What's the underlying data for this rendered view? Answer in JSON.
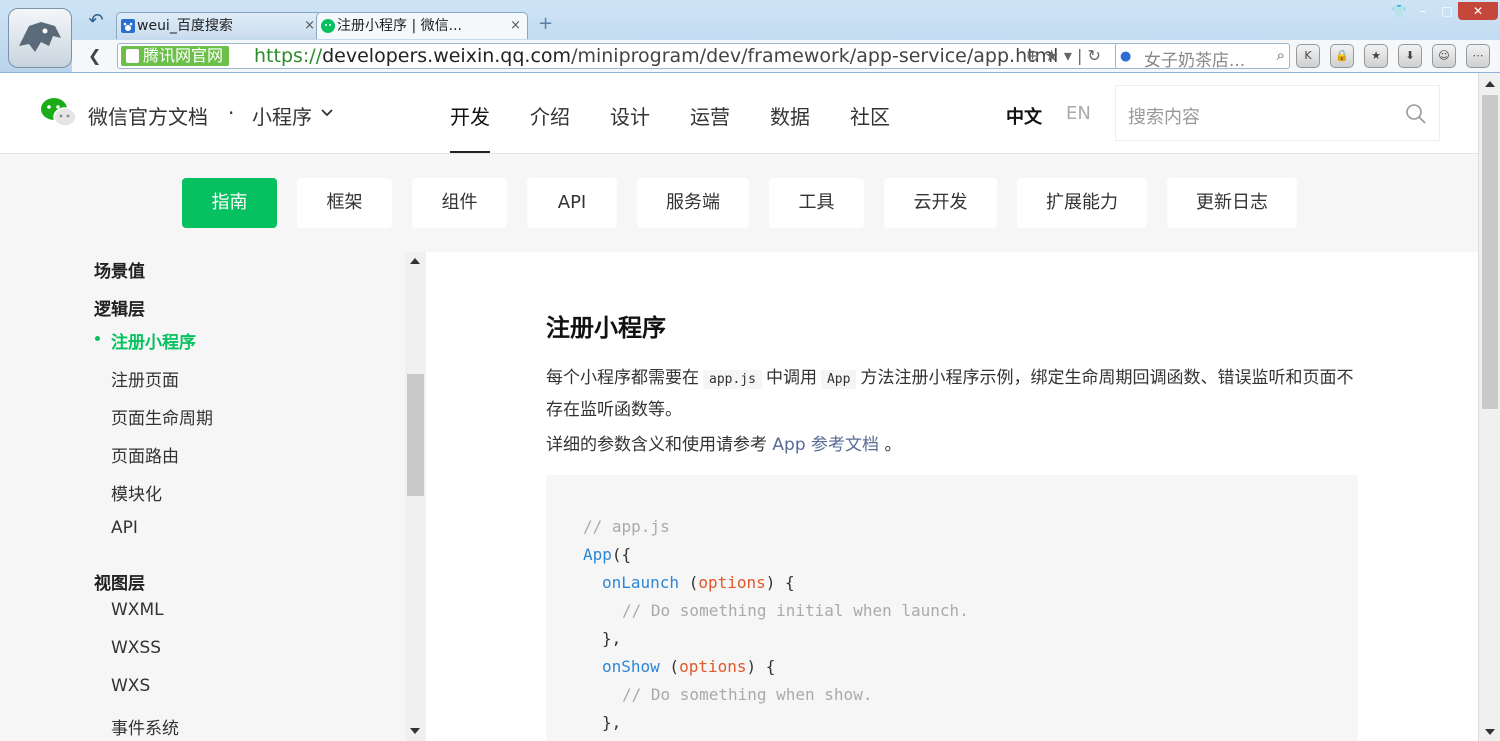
{
  "browser": {
    "tabs": [
      {
        "label": "weui_百度搜索",
        "close": "×"
      },
      {
        "label": "注册小程序 | 微信...",
        "close": "×"
      }
    ],
    "new_tab": "+",
    "window_controls": {
      "skin": "👕",
      "minimize": "–",
      "maximize": "□",
      "close": "✕"
    },
    "back": "❮",
    "site_badge": "腾讯网官网",
    "url": {
      "scheme": "https://",
      "host": "developers.weixin.qq.com",
      "path": "/miniprogram/dev/framework/app-service/app.html"
    },
    "url_icons": "⊕ ★ ▾ | ↻",
    "search": {
      "placeholder": "女子奶茶店...",
      "engine_icon": "baidu-paw-icon"
    },
    "extensions": [
      "K",
      "🔒",
      "★",
      "⬇",
      "☺",
      "⋯"
    ]
  },
  "header": {
    "brand": "微信官方文档",
    "separator": "·",
    "product": "小程序",
    "nav": [
      {
        "label": "开发",
        "active": true
      },
      {
        "label": "介绍"
      },
      {
        "label": "设计"
      },
      {
        "label": "运营"
      },
      {
        "label": "数据"
      },
      {
        "label": "社区"
      }
    ],
    "lang_zh": "中文",
    "lang_en": "EN",
    "search_placeholder": "搜索内容"
  },
  "categories": [
    {
      "label": "指南",
      "active": true
    },
    {
      "label": "框架"
    },
    {
      "label": "组件"
    },
    {
      "label": "API"
    },
    {
      "label": "服务端"
    },
    {
      "label": "工具"
    },
    {
      "label": "云开发"
    },
    {
      "label": "扩展能力"
    },
    {
      "label": "更新日志"
    }
  ],
  "sidebar": {
    "groups": [
      "场景值",
      "逻辑层",
      "视图层"
    ],
    "items": [
      "注册小程序",
      "注册页面",
      "页面生命周期",
      "页面路由",
      "模块化",
      "API",
      "WXML",
      "WXSS",
      "WXS",
      "事件系统"
    ]
  },
  "content": {
    "title": "注册小程序",
    "p1_a": "每个小程序都需要在",
    "p1_code1": "app.js",
    "p1_b": "中调用",
    "p1_code2": "App",
    "p1_c": "方法注册小程序示例，绑定生命周期回调函数、错误监听和页面不存在监听函数等。",
    "p2_a": "详细的参数含义和使用请参考",
    "p2_link": "App 参考文档",
    "p2_b": "。",
    "code": {
      "l1": "// app.js",
      "l2_fn": "App",
      "l2_rest": "({",
      "l3_fn": "onLaunch",
      "l3_a": " (",
      "l3_param": "options",
      "l3_b": ") {",
      "l4": "// Do something initial when launch.",
      "l5": "},",
      "l6_fn": "onShow",
      "l6_a": " (",
      "l6_param": "options",
      "l6_b": ") {",
      "l7": "// Do something when show.",
      "l8": "},"
    }
  },
  "colors": {
    "accent": "#07c160",
    "link": "#576b95",
    "code_function": "#2f86d6",
    "code_param": "#e0582b"
  }
}
